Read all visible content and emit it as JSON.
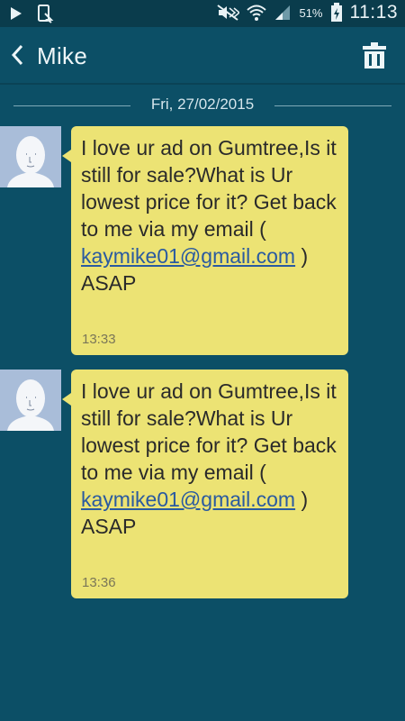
{
  "status_bar": {
    "battery_percent": "51%",
    "time": "11:13"
  },
  "header": {
    "contact_name": "Mike"
  },
  "date_separator": "Fri, 27/02/2015",
  "messages": [
    {
      "text_before": "I love ur ad on Gumtree,Is it still for sale?What is Ur lowest price for it? Get back to me via my email (",
      "email": "kaymike01@gmail.com",
      "text_after": ") ASAP",
      "time": "13:33"
    },
    {
      "text_before": "I love ur ad on Gumtree,Is it still for sale?What is Ur lowest price for it? Get back to me via my email (",
      "email": "kaymike01@gmail.com",
      "text_after": ") ASAP",
      "time": "13:36"
    }
  ],
  "colors": {
    "background": "#0c4f66",
    "bubble": "#ece374",
    "link": "#2a5aa0"
  }
}
